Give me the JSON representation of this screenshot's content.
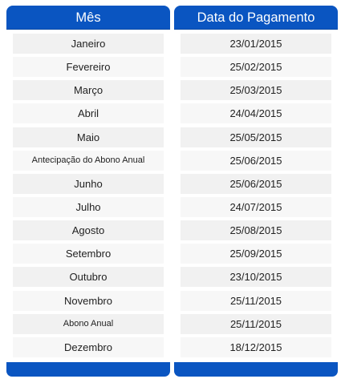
{
  "table": {
    "headers": {
      "month": "Mês",
      "payment_date": "Data do Pagamento"
    },
    "rows": [
      {
        "month": "Janeiro",
        "date": "23/01/2015"
      },
      {
        "month": "Fevereiro",
        "date": "25/02/2015"
      },
      {
        "month": "Março",
        "date": "25/03/2015"
      },
      {
        "month": "Abril",
        "date": "24/04/2015"
      },
      {
        "month": "Maio",
        "date": "25/05/2015"
      },
      {
        "month": "Antecipação do Abono Anual",
        "date": "25/06/2015"
      },
      {
        "month": "Junho",
        "date": "25/06/2015"
      },
      {
        "month": "Julho",
        "date": "24/07/2015"
      },
      {
        "month": "Agosto",
        "date": "25/08/2015"
      },
      {
        "month": "Setembro",
        "date": "25/09/2015"
      },
      {
        "month": "Outubro",
        "date": "23/10/2015"
      },
      {
        "month": "Novembro",
        "date": "25/11/2015"
      },
      {
        "month": "Abono Anual",
        "date": "25/11/2015"
      },
      {
        "month": "Dezembro",
        "date": "18/12/2015"
      }
    ]
  },
  "colors": {
    "header_blue": "#0a55c1",
    "row_bg": "#f1f1f1",
    "text": "#222222"
  }
}
